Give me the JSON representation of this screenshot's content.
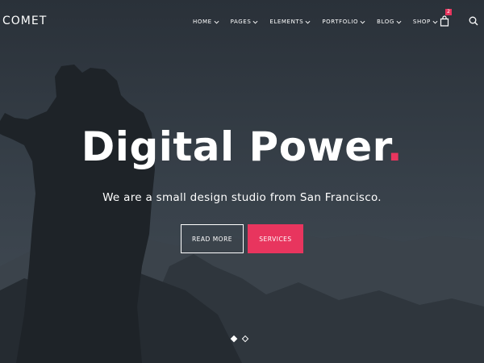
{
  "brand": {
    "logo": "COMET"
  },
  "nav": {
    "items": [
      {
        "label": "HOME"
      },
      {
        "label": "PAGES"
      },
      {
        "label": "ELEMENTS"
      },
      {
        "label": "PORTFOLIO"
      },
      {
        "label": "BLOG"
      },
      {
        "label": "SHOP"
      }
    ],
    "cart_count": "2",
    "cart_icon": "shopping-bag-icon",
    "search_icon": "search-icon",
    "chevron_icon": "chevron-down-icon"
  },
  "hero": {
    "headline": "Digital Power",
    "headline_dot": ".",
    "subheadline": "We are a small design studio from San Francisco.",
    "buttons": {
      "read_more": "READ MORE",
      "services": "SERVICES"
    },
    "slider": {
      "count": 2,
      "active_index": 0
    }
  },
  "colors": {
    "accent": "#e8355e",
    "text": "#ffffff",
    "background": "#323a42"
  }
}
